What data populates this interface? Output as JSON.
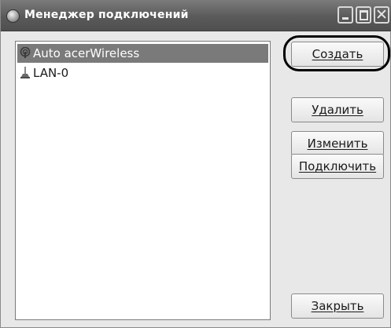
{
  "window": {
    "title": "Менеджер подключений"
  },
  "connections": [
    {
      "label": "Auto acerWireless",
      "icon": "wireless-icon",
      "selected": true
    },
    {
      "label": "LAN-0",
      "icon": "lan-icon",
      "selected": false
    }
  ],
  "buttons": {
    "create": "Создать",
    "delete": "Удалить",
    "edit": "Изменить",
    "connect": "Подключить",
    "close": "Закрыть"
  },
  "colors": {
    "titlebar": "#5a5a5a",
    "selection": "#7a7a7a",
    "highlight_ring": "#000000"
  }
}
